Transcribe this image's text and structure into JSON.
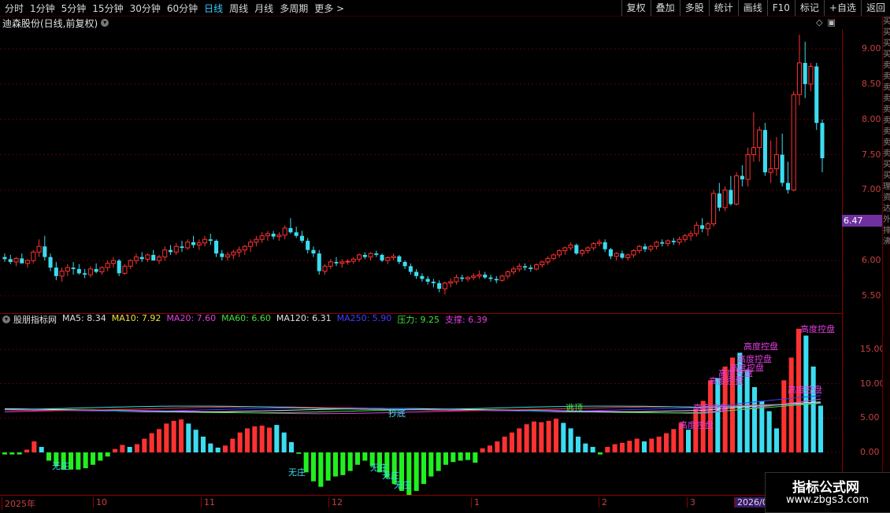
{
  "toolbar": {
    "left_items": [
      "分时",
      "1分钟",
      "5分钟",
      "15分钟",
      "30分钟",
      "60分钟",
      "日线",
      "周线",
      "月线",
      "多周期",
      "更多 >"
    ],
    "active_index": 6,
    "right_items": [
      "复权",
      "叠加",
      "多股",
      "统计",
      "画线",
      "F10",
      "标记",
      "+自选",
      "返回"
    ]
  },
  "chart_title": "迪森股份(日线,前复权)",
  "sidebar_chars": [
    "买",
    "买",
    "买",
    "买",
    "卖",
    "卖",
    "卖",
    "卖",
    "卖",
    "卖",
    "卖",
    "卖",
    "卖",
    "买",
    "买",
    "理",
    "资",
    "达",
    "外",
    "排",
    "沸"
  ],
  "price_tag": "6.47",
  "price_axis": {
    "ticks": [
      "9.00",
      "8.50",
      "8.00",
      "7.50",
      "7.00",
      "6.00",
      "5.50"
    ],
    "values": [
      9.0,
      8.5,
      8.0,
      7.5,
      7.0,
      6.0,
      5.5
    ]
  },
  "indicator": {
    "name": "股朋指标网",
    "items": [
      {
        "label": "MA5: 8.34",
        "color": "#e0e0e0"
      },
      {
        "label": "MA10: 7.92",
        "color": "#f0e040"
      },
      {
        "label": "MA20: 7.60",
        "color": "#e040e0"
      },
      {
        "label": "MA60: 6.60",
        "color": "#40e040"
      },
      {
        "label": "MA120: 6.31",
        "color": "#e0e0e0"
      },
      {
        "label": "MA250: 5.90",
        "color": "#4040ff"
      },
      {
        "label": "压力: 9.25",
        "color": "#40e040"
      },
      {
        "label": "支撑: 6.39",
        "color": "#e040e0"
      }
    ],
    "axis_ticks": [
      "15.00",
      "10.00",
      "5.00",
      "0.00"
    ],
    "axis_values": [
      15,
      10,
      5,
      0
    ]
  },
  "annotations": {
    "wuzhuang": "无庄",
    "chaodi": "抄底",
    "taoding": "逃顶",
    "gaodu": "高度控盘"
  },
  "time_axis": [
    "2025年",
    "10",
    "11",
    "12",
    "1",
    "2",
    "3",
    "2026/0"
  ],
  "watermark": {
    "line1": "指标公式网",
    "line2": "www.zbgs3.com"
  },
  "colors": {
    "up": "#ff3232",
    "down": "#3cdcf0",
    "green_bar": "#20f020",
    "bg": "#000000",
    "grid": "#5a0000"
  },
  "chart_data": {
    "type": "candlestick",
    "ohlc": [
      [
        6.05,
        6.1,
        5.98,
        6.02
      ],
      [
        6.02,
        6.08,
        5.95,
        5.98
      ],
      [
        5.98,
        6.05,
        5.92,
        6.03
      ],
      [
        6.03,
        6.1,
        5.98,
        5.96
      ],
      [
        5.96,
        6.02,
        5.9,
        6.0
      ],
      [
        6.0,
        6.15,
        5.96,
        6.12
      ],
      [
        6.12,
        6.3,
        6.05,
        6.2
      ],
      [
        6.2,
        6.35,
        6.0,
        6.05
      ],
      [
        6.05,
        6.1,
        5.85,
        5.9
      ],
      [
        5.9,
        5.98,
        5.72,
        5.78
      ],
      [
        5.78,
        5.9,
        5.7,
        5.85
      ],
      [
        5.85,
        5.95,
        5.78,
        5.9
      ],
      [
        5.9,
        5.98,
        5.8,
        5.88
      ],
      [
        5.88,
        5.95,
        5.8,
        5.82
      ],
      [
        5.82,
        5.88,
        5.75,
        5.8
      ],
      [
        5.8,
        5.92,
        5.76,
        5.88
      ],
      [
        5.88,
        5.96,
        5.82,
        5.84
      ],
      [
        5.84,
        5.92,
        5.8,
        5.9
      ],
      [
        5.9,
        6.0,
        5.85,
        5.96
      ],
      [
        5.96,
        6.05,
        5.9,
        6.0
      ],
      [
        6.0,
        6.02,
        5.78,
        5.82
      ],
      [
        5.82,
        5.95,
        5.8,
        5.92
      ],
      [
        5.92,
        6.02,
        5.88,
        6.0
      ],
      [
        6.0,
        6.1,
        5.95,
        6.05
      ],
      [
        6.05,
        6.12,
        5.98,
        6.02
      ],
      [
        6.02,
        6.1,
        5.98,
        6.08
      ],
      [
        6.08,
        6.15,
        6.02,
        6.0
      ],
      [
        6.0,
        6.08,
        5.95,
        6.05
      ],
      [
        6.05,
        6.2,
        6.0,
        6.15
      ],
      [
        6.15,
        6.22,
        6.08,
        6.12
      ],
      [
        6.12,
        6.25,
        6.08,
        6.2
      ],
      [
        6.2,
        6.28,
        6.12,
        6.18
      ],
      [
        6.18,
        6.3,
        6.15,
        6.26
      ],
      [
        6.26,
        6.35,
        6.18,
        6.22
      ],
      [
        6.22,
        6.3,
        6.15,
        6.25
      ],
      [
        6.25,
        6.35,
        6.2,
        6.3
      ],
      [
        6.3,
        6.38,
        6.22,
        6.28
      ],
      [
        6.28,
        6.3,
        6.05,
        6.1
      ],
      [
        6.1,
        6.15,
        6.0,
        6.05
      ],
      [
        6.05,
        6.12,
        6.0,
        6.08
      ],
      [
        6.08,
        6.15,
        6.02,
        6.12
      ],
      [
        6.12,
        6.2,
        6.05,
        6.15
      ],
      [
        6.15,
        6.22,
        6.08,
        6.2
      ],
      [
        6.2,
        6.3,
        6.12,
        6.26
      ],
      [
        6.26,
        6.35,
        6.2,
        6.3
      ],
      [
        6.3,
        6.4,
        6.25,
        6.35
      ],
      [
        6.35,
        6.42,
        6.28,
        6.38
      ],
      [
        6.38,
        6.42,
        6.3,
        6.34
      ],
      [
        6.34,
        6.4,
        6.28,
        6.36
      ],
      [
        6.36,
        6.5,
        6.3,
        6.46
      ],
      [
        6.46,
        6.6,
        6.38,
        6.4
      ],
      [
        6.4,
        6.48,
        6.32,
        6.35
      ],
      [
        6.35,
        6.42,
        6.25,
        6.28
      ],
      [
        6.28,
        6.32,
        6.1,
        6.15
      ],
      [
        6.15,
        6.2,
        6.05,
        6.1
      ],
      [
        6.1,
        6.15,
        5.8,
        5.85
      ],
      [
        5.85,
        5.95,
        5.8,
        5.92
      ],
      [
        5.92,
        6.02,
        5.88,
        5.98
      ],
      [
        5.98,
        6.05,
        5.92,
        5.96
      ],
      [
        5.96,
        6.02,
        5.9,
        5.98
      ],
      [
        5.98,
        6.02,
        5.94,
        5.99
      ],
      [
        5.99,
        6.05,
        5.95,
        6.02
      ],
      [
        6.02,
        6.1,
        5.98,
        6.08
      ],
      [
        6.08,
        6.12,
        6.02,
        6.05
      ],
      [
        6.05,
        6.12,
        6.0,
        6.1
      ],
      [
        6.1,
        6.14,
        6.05,
        6.08
      ],
      [
        6.08,
        6.1,
        5.98,
        6.0
      ],
      [
        6.0,
        6.06,
        5.95,
        6.04
      ],
      [
        6.04,
        6.1,
        6.0,
        6.06
      ],
      [
        6.06,
        6.08,
        5.95,
        5.98
      ],
      [
        5.98,
        6.0,
        5.88,
        5.92
      ],
      [
        5.92,
        5.96,
        5.8,
        5.84
      ],
      [
        5.84,
        5.88,
        5.74,
        5.78
      ],
      [
        5.78,
        5.82,
        5.7,
        5.74
      ],
      [
        5.74,
        5.78,
        5.66,
        5.7
      ],
      [
        5.7,
        5.74,
        5.62,
        5.68
      ],
      [
        5.68,
        5.72,
        5.55,
        5.6
      ],
      [
        5.6,
        5.7,
        5.52,
        5.68
      ],
      [
        5.68,
        5.75,
        5.62,
        5.7
      ],
      [
        5.7,
        5.8,
        5.66,
        5.76
      ],
      [
        5.76,
        5.8,
        5.7,
        5.74
      ],
      [
        5.74,
        5.78,
        5.7,
        5.76
      ],
      [
        5.76,
        5.82,
        5.72,
        5.78
      ],
      [
        5.78,
        5.86,
        5.74,
        5.8
      ],
      [
        5.8,
        5.84,
        5.74,
        5.76
      ],
      [
        5.76,
        5.8,
        5.7,
        5.74
      ],
      [
        5.74,
        5.78,
        5.68,
        5.72
      ],
      [
        5.72,
        5.8,
        5.7,
        5.78
      ],
      [
        5.78,
        5.86,
        5.74,
        5.84
      ],
      [
        5.84,
        5.92,
        5.8,
        5.88
      ],
      [
        5.88,
        5.96,
        5.84,
        5.92
      ],
      [
        5.92,
        5.96,
        5.86,
        5.9
      ],
      [
        5.9,
        5.94,
        5.84,
        5.88
      ],
      [
        5.88,
        5.96,
        5.86,
        5.94
      ],
      [
        5.94,
        6.0,
        5.9,
        5.98
      ],
      [
        5.98,
        6.06,
        5.94,
        6.03
      ],
      [
        6.03,
        6.1,
        6.0,
        6.08
      ],
      [
        6.08,
        6.16,
        6.04,
        6.14
      ],
      [
        6.14,
        6.2,
        6.08,
        6.18
      ],
      [
        6.18,
        6.26,
        6.14,
        6.22
      ],
      [
        6.22,
        6.24,
        6.08,
        6.1
      ],
      [
        6.1,
        6.16,
        6.06,
        6.14
      ],
      [
        6.14,
        6.2,
        6.1,
        6.18
      ],
      [
        6.18,
        6.26,
        6.14,
        6.24
      ],
      [
        6.24,
        6.3,
        6.2,
        6.26
      ],
      [
        6.26,
        6.3,
        6.12,
        6.16
      ],
      [
        6.16,
        6.18,
        6.02,
        6.06
      ],
      [
        6.06,
        6.12,
        6.0,
        6.1
      ],
      [
        6.1,
        6.14,
        6.02,
        6.04
      ],
      [
        6.04,
        6.1,
        6.0,
        6.08
      ],
      [
        6.08,
        6.16,
        6.04,
        6.14
      ],
      [
        6.14,
        6.22,
        6.1,
        6.2
      ],
      [
        6.2,
        6.24,
        6.12,
        6.16
      ],
      [
        6.16,
        6.22,
        6.12,
        6.2
      ],
      [
        6.2,
        6.28,
        6.16,
        6.26
      ],
      [
        6.26,
        6.3,
        6.2,
        6.24
      ],
      [
        6.24,
        6.3,
        6.2,
        6.28
      ],
      [
        6.28,
        6.32,
        6.22,
        6.26
      ],
      [
        6.26,
        6.34,
        6.22,
        6.3
      ],
      [
        6.3,
        6.38,
        6.26,
        6.35
      ],
      [
        6.35,
        6.42,
        6.28,
        6.38
      ],
      [
        6.38,
        6.55,
        6.34,
        6.5
      ],
      [
        6.5,
        6.6,
        6.4,
        6.45
      ],
      [
        6.45,
        6.55,
        6.35,
        6.52
      ],
      [
        6.52,
        7.0,
        6.48,
        6.95
      ],
      [
        6.95,
        7.1,
        6.7,
        6.75
      ],
      [
        6.75,
        7.05,
        6.7,
        7.0
      ],
      [
        7.0,
        7.2,
        6.78,
        6.8
      ],
      [
        6.8,
        7.25,
        6.78,
        7.2
      ],
      [
        7.2,
        7.35,
        7.05,
        7.15
      ],
      [
        7.15,
        7.6,
        7.05,
        7.5
      ],
      [
        7.5,
        8.1,
        7.4,
        7.6
      ],
      [
        7.6,
        7.9,
        7.4,
        7.85
      ],
      [
        7.85,
        7.95,
        7.2,
        7.25
      ],
      [
        7.25,
        7.7,
        7.1,
        7.3
      ],
      [
        7.3,
        7.75,
        7.2,
        7.5
      ],
      [
        7.5,
        7.8,
        7.05,
        7.1
      ],
      [
        7.1,
        7.4,
        6.95,
        7.0
      ],
      [
        7.0,
        8.4,
        6.98,
        8.35
      ],
      [
        8.35,
        9.2,
        8.2,
        8.8
      ],
      [
        8.8,
        9.1,
        8.3,
        8.5
      ],
      [
        8.5,
        8.8,
        8.4,
        8.75
      ],
      [
        8.75,
        8.8,
        7.85,
        7.95
      ],
      [
        7.95,
        8.0,
        7.25,
        7.45
      ]
    ],
    "indicator_bars": [
      {
        "color": "green",
        "v": -0.3
      },
      {
        "color": "green",
        "v": -0.3
      },
      {
        "color": "green",
        "v": -0.3
      },
      {
        "color": "red",
        "v": 0.4
      },
      {
        "color": "red",
        "v": 1.6
      },
      {
        "color": "cyan",
        "v": 0.8
      },
      {
        "color": "green",
        "v": -1.2
      },
      {
        "color": "green",
        "v": -2.0
      },
      {
        "color": "green",
        "v": -2.5
      },
      {
        "color": "green",
        "v": -2.5
      },
      {
        "color": "green",
        "v": -2.5
      },
      {
        "color": "green",
        "v": -2.3
      },
      {
        "color": "green",
        "v": -1.8
      },
      {
        "color": "green",
        "v": -1.2
      },
      {
        "color": "green",
        "v": -0.6
      },
      {
        "color": "red",
        "v": 0.5
      },
      {
        "color": "red",
        "v": 1.1
      },
      {
        "color": "cyan",
        "v": 0.8
      },
      {
        "color": "red",
        "v": 1.2
      },
      {
        "color": "red",
        "v": 2.0
      },
      {
        "color": "red",
        "v": 2.8
      },
      {
        "color": "red",
        "v": 3.4
      },
      {
        "color": "red",
        "v": 4.2
      },
      {
        "color": "red",
        "v": 4.6
      },
      {
        "color": "red",
        "v": 4.8
      },
      {
        "color": "cyan",
        "v": 4.2
      },
      {
        "color": "cyan",
        "v": 3.3
      },
      {
        "color": "cyan",
        "v": 2.3
      },
      {
        "color": "cyan",
        "v": 1.3
      },
      {
        "color": "cyan",
        "v": 0.7
      },
      {
        "color": "red",
        "v": 1.0
      },
      {
        "color": "red",
        "v": 2.0
      },
      {
        "color": "red",
        "v": 2.9
      },
      {
        "color": "red",
        "v": 3.5
      },
      {
        "color": "red",
        "v": 3.8
      },
      {
        "color": "red",
        "v": 3.9
      },
      {
        "color": "red",
        "v": 3.6
      },
      {
        "color": "cyan",
        "v": 4.0
      },
      {
        "color": "cyan",
        "v": 2.9
      },
      {
        "color": "cyan",
        "v": 1.5
      },
      {
        "color": "green",
        "v": -0.2
      },
      {
        "color": "green",
        "v": -2.9
      },
      {
        "color": "green",
        "v": -4.2
      },
      {
        "color": "green",
        "v": -5.0
      },
      {
        "color": "green",
        "v": -4.1
      },
      {
        "color": "green",
        "v": -3.5
      },
      {
        "color": "green",
        "v": -3.3
      },
      {
        "color": "green",
        "v": -2.7
      },
      {
        "color": "green",
        "v": -1.8
      },
      {
        "color": "green",
        "v": -1.2
      },
      {
        "color": "green",
        "v": -2.0
      },
      {
        "color": "green",
        "v": -2.9
      },
      {
        "color": "green",
        "v": -3.7
      },
      {
        "color": "green",
        "v": -4.6
      },
      {
        "color": "green",
        "v": -5.6
      },
      {
        "color": "green",
        "v": -6.2
      },
      {
        "color": "green",
        "v": -5.6
      },
      {
        "color": "green",
        "v": -4.6
      },
      {
        "color": "green",
        "v": -3.5
      },
      {
        "color": "green",
        "v": -2.7
      },
      {
        "color": "green",
        "v": -1.8
      },
      {
        "color": "green",
        "v": -1.4
      },
      {
        "color": "green",
        "v": -1.2
      },
      {
        "color": "green",
        "v": -1.1
      },
      {
        "color": "green",
        "v": -1.5
      },
      {
        "color": "red",
        "v": 0.6
      },
      {
        "color": "red",
        "v": 1.0
      },
      {
        "color": "red",
        "v": 1.6
      },
      {
        "color": "red",
        "v": 2.3
      },
      {
        "color": "red",
        "v": 2.9
      },
      {
        "color": "red",
        "v": 3.5
      },
      {
        "color": "red",
        "v": 4.1
      },
      {
        "color": "red",
        "v": 4.5
      },
      {
        "color": "red",
        "v": 4.4
      },
      {
        "color": "red",
        "v": 4.6
      },
      {
        "color": "red",
        "v": 4.9
      },
      {
        "color": "cyan",
        "v": 4.3
      },
      {
        "color": "cyan",
        "v": 3.5
      },
      {
        "color": "cyan",
        "v": 2.3
      },
      {
        "color": "cyan",
        "v": 1.3
      },
      {
        "color": "cyan",
        "v": 0.8
      },
      {
        "color": "green",
        "v": -0.3
      },
      {
        "color": "red",
        "v": 0.8
      },
      {
        "color": "red",
        "v": 1.2
      },
      {
        "color": "red",
        "v": 1.4
      },
      {
        "color": "red",
        "v": 1.7
      },
      {
        "color": "red",
        "v": 2.0
      },
      {
        "color": "cyan",
        "v": 1.6
      },
      {
        "color": "red",
        "v": 2.0
      },
      {
        "color": "red",
        "v": 2.3
      },
      {
        "color": "red",
        "v": 2.8
      },
      {
        "color": "red",
        "v": 3.4
      },
      {
        "color": "red",
        "v": 4.3
      },
      {
        "color": "cyan",
        "v": 3.3
      },
      {
        "color": "red",
        "v": 6.3
      },
      {
        "color": "red",
        "v": 7.5
      },
      {
        "color": "red",
        "v": 10.5
      },
      {
        "color": "cyan",
        "v": 10.8
      },
      {
        "color": "red",
        "v": 12.5
      },
      {
        "color": "red",
        "v": 13.8
      },
      {
        "color": "cyan",
        "v": 14.5
      },
      {
        "color": "cyan",
        "v": 12.0
      },
      {
        "color": "cyan",
        "v": 9.5
      },
      {
        "color": "cyan",
        "v": 7.5
      },
      {
        "color": "cyan",
        "v": 6.0
      },
      {
        "color": "cyan",
        "v": 3.5
      },
      {
        "color": "red",
        "v": 10.5
      },
      {
        "color": "red",
        "v": 13.8
      },
      {
        "color": "red",
        "v": 18.0
      },
      {
        "color": "cyan",
        "v": 17.0
      },
      {
        "color": "cyan",
        "v": 12.5
      },
      {
        "color": "cyan",
        "v": 6.8
      }
    ]
  }
}
